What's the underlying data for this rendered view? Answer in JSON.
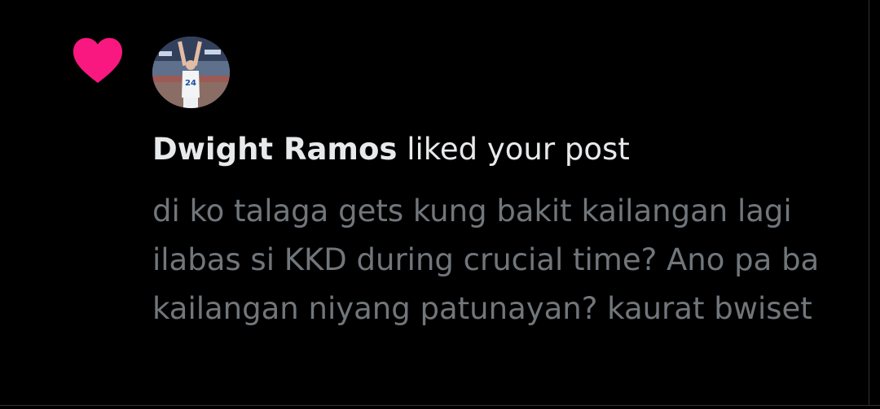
{
  "notification": {
    "type_icon": "heart-icon",
    "avatar_icon": "avatar",
    "user_name": "Dwight Ramos",
    "action_text": "liked your post",
    "post_text": "di ko talaga gets kung bakit kailangan lagi ilabas si KKD during crucial time? Ano pa ba kailangan niyang patunayan? kaurat bwiset"
  },
  "colors": {
    "background": "#000000",
    "heart": "#f91880",
    "primary_text": "#e7e9ea",
    "secondary_text": "#71767b",
    "divider": "#2f3336"
  }
}
